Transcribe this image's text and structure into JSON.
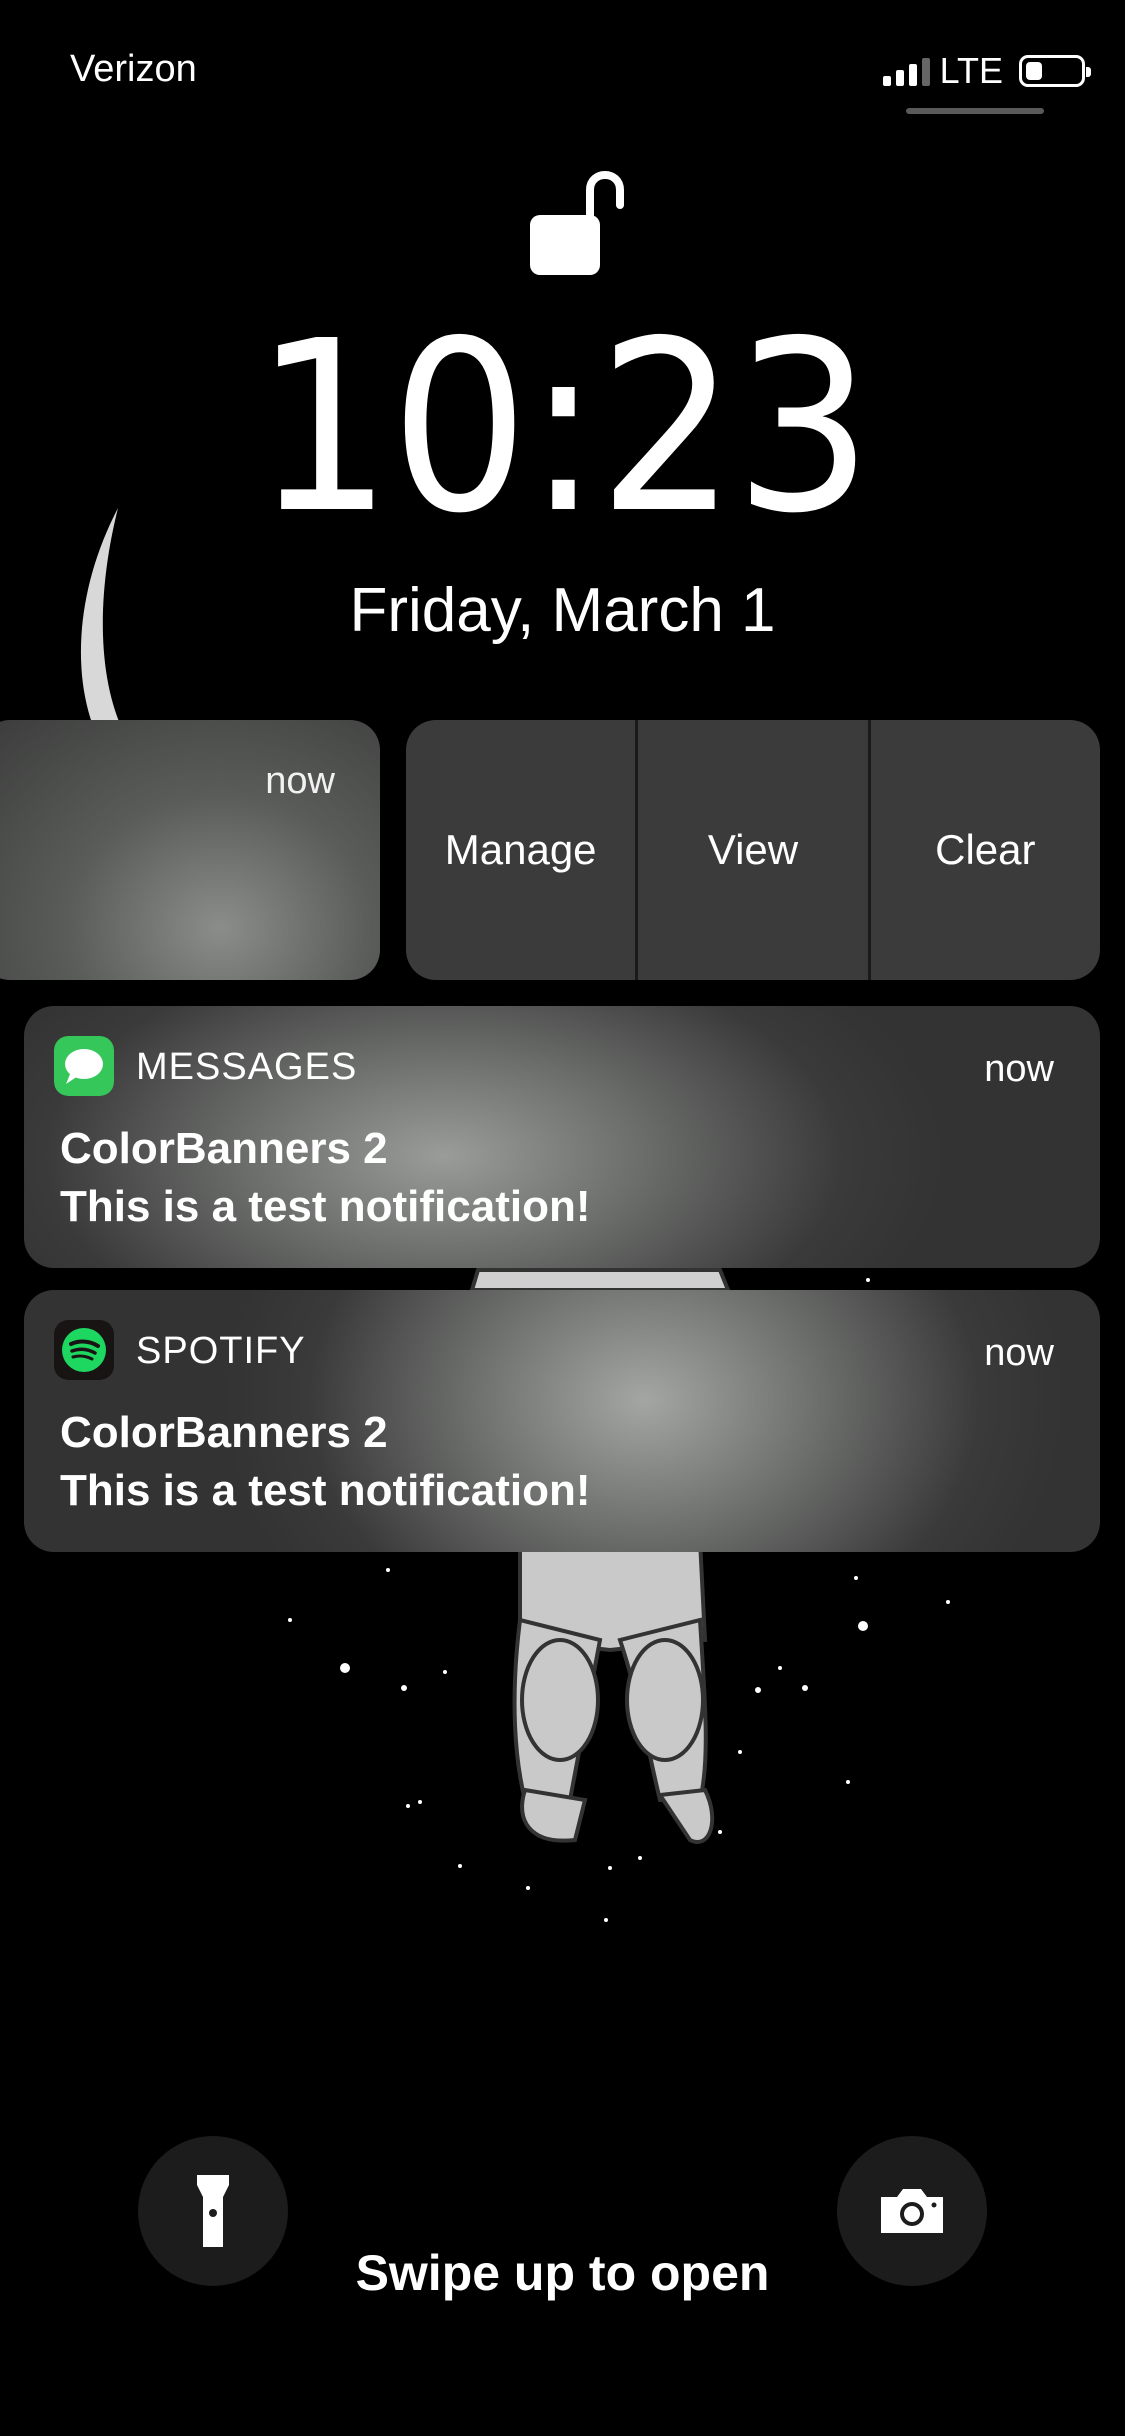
{
  "status_bar": {
    "carrier": "Verizon",
    "network": "LTE",
    "signal_bars": 3,
    "battery_level": 0.3
  },
  "lock_screen": {
    "lock_state": "unlocked",
    "time": "10:23",
    "date": "Friday, March 1",
    "swipe_hint": "Swipe up to open"
  },
  "swiped_notification": {
    "time": "now",
    "actions": [
      "Manage",
      "View",
      "Clear"
    ]
  },
  "notifications": [
    {
      "app": "MESSAGES",
      "icon": "messages-icon",
      "icon_color": "#35C759",
      "time": "now",
      "title": "ColorBanners 2",
      "body": "This is a test notification!"
    },
    {
      "app": "SPOTIFY",
      "icon": "spotify-icon",
      "icon_color": "#1ED760",
      "time": "now",
      "title": "ColorBanners 2",
      "body": "This is a test notification!"
    }
  ],
  "quick_actions": {
    "left": "flashlight-icon",
    "right": "camera-icon"
  }
}
